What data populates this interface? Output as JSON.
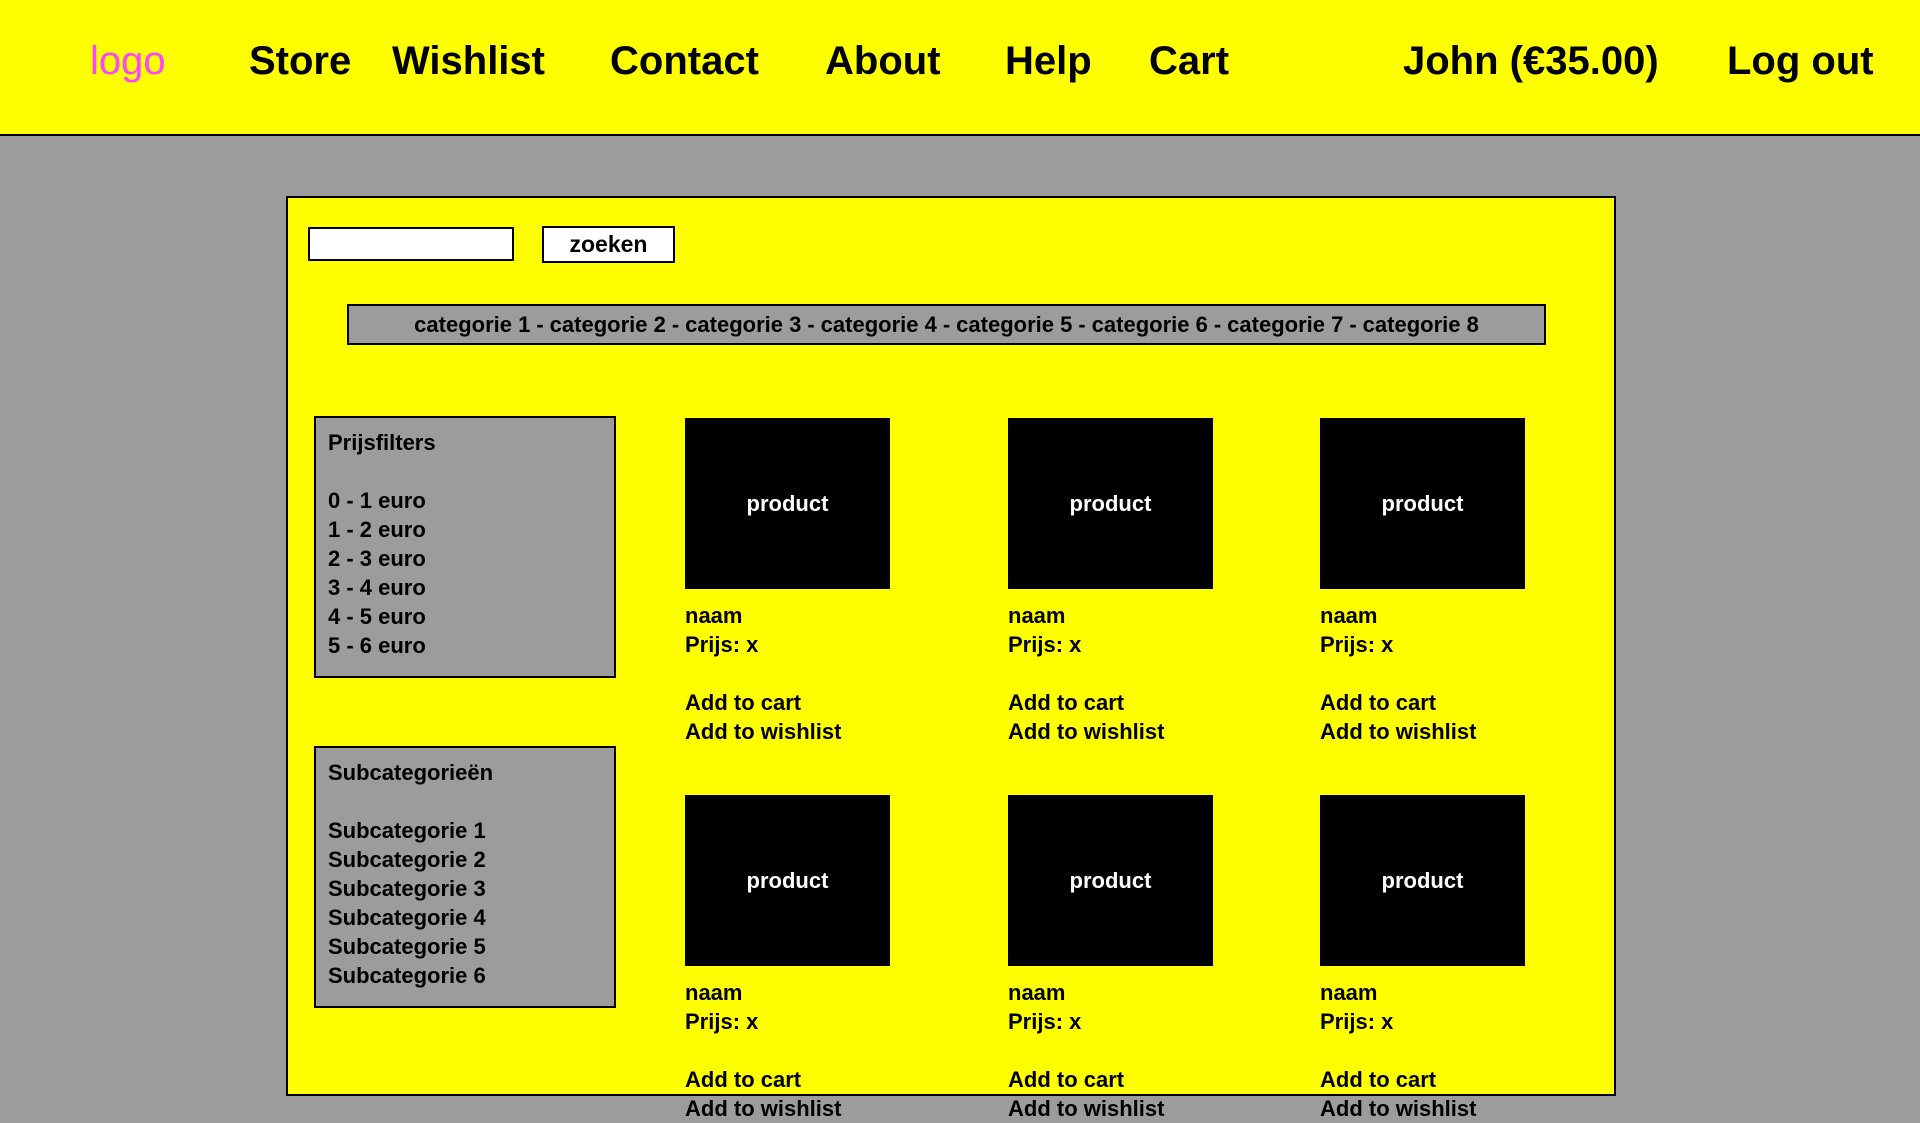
{
  "nav": {
    "logo": "logo",
    "store": "Store",
    "wishlist": "Wishlist",
    "contact": "Contact",
    "about": "About",
    "help": "Help",
    "cart": "Cart",
    "user": "John (€35.00)",
    "logout": "Log out"
  },
  "search": {
    "value": "",
    "button_label": "zoeken"
  },
  "categories": [
    "categorie 1",
    "categorie 2",
    "categorie 3",
    "categorie 4",
    "categorie 5",
    "categorie 6",
    "categorie 7",
    "categorie 8"
  ],
  "category_separator": "-",
  "price_filters": {
    "title": "Prijsfilters",
    "items": [
      "0 - 1 euro",
      "1 - 2 euro",
      "2 - 3 euro",
      "3 - 4 euro",
      "4 - 5 euro",
      "5 - 6 euro"
    ]
  },
  "subcategories": {
    "title": "Subcategorieën",
    "items": [
      "Subcategorie 1",
      "Subcategorie 2",
      "Subcategorie 3",
      "Subcategorie 4",
      "Subcategorie 5",
      "Subcategorie 6"
    ]
  },
  "products": [
    {
      "image_label": "product",
      "name": "naam",
      "price": "Prijs: x",
      "add_to_cart": "Add to cart",
      "add_to_wishlist": "Add to wishlist"
    },
    {
      "image_label": "product",
      "name": "naam",
      "price": "Prijs: x",
      "add_to_cart": "Add to cart",
      "add_to_wishlist": "Add to wishlist"
    },
    {
      "image_label": "product",
      "name": "naam",
      "price": "Prijs: x",
      "add_to_cart": "Add to cart",
      "add_to_wishlist": "Add to wishlist"
    },
    {
      "image_label": "product",
      "name": "naam",
      "price": "Prijs: x",
      "add_to_cart": "Add to cart",
      "add_to_wishlist": "Add to wishlist"
    },
    {
      "image_label": "product",
      "name": "naam",
      "price": "Prijs: x",
      "add_to_cart": "Add to cart",
      "add_to_wishlist": "Add to wishlist"
    },
    {
      "image_label": "product",
      "name": "naam",
      "price": "Prijs: x",
      "add_to_cart": "Add to cart",
      "add_to_wishlist": "Add to wishlist"
    }
  ],
  "colors": {
    "background": "#9c9c9c",
    "accent": "#ffff00",
    "logo": "#ff44ff",
    "product_image": "#000000"
  }
}
